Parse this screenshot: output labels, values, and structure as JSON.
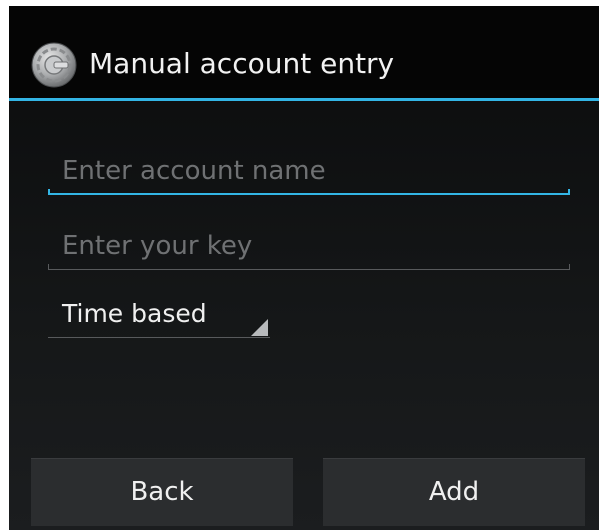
{
  "title_bar": {
    "icon": "google-authenticator-icon",
    "title": "Manual account entry"
  },
  "form": {
    "account_name": {
      "value": "",
      "placeholder": "Enter account name",
      "focused": true
    },
    "key": {
      "value": "",
      "placeholder": "Enter your key"
    },
    "type_select": {
      "selected": "Time based"
    }
  },
  "buttons": {
    "back_label": "Back",
    "add_label": "Add"
  },
  "colors": {
    "accent": "#33b5e5",
    "background": "#101213",
    "button": "#2b2d2f"
  }
}
